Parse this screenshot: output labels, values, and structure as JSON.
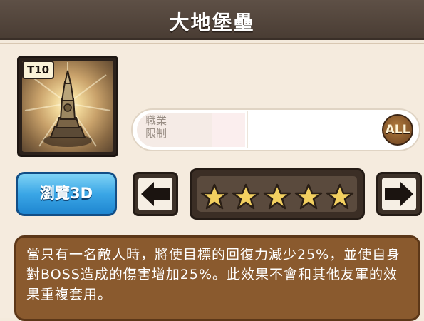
{
  "header": {
    "title": "大地堡壘"
  },
  "item": {
    "tier": "T10",
    "icon": "stone-totem-icon"
  },
  "restriction": {
    "label": "職業\n限制",
    "label_line1": "職業",
    "label_line2": "限制",
    "class": "ALL"
  },
  "buttons": {
    "view_3d": "瀏覽3D",
    "prev": "arrow-left-icon",
    "next": "arrow-right-icon"
  },
  "rating": {
    "stars": 5,
    "max_stars": 5
  },
  "description": "當只有一名敵人時，將使目標的回復力減少25%，並使自身對BOSS造成的傷害增加25%。此效果不會和其他友軍的效果重複套用。",
  "colors": {
    "header": "#4a3d34",
    "button_blue": "#3aa6e6",
    "desc_bg": "#8a5a2e",
    "star": "#f3d060"
  }
}
